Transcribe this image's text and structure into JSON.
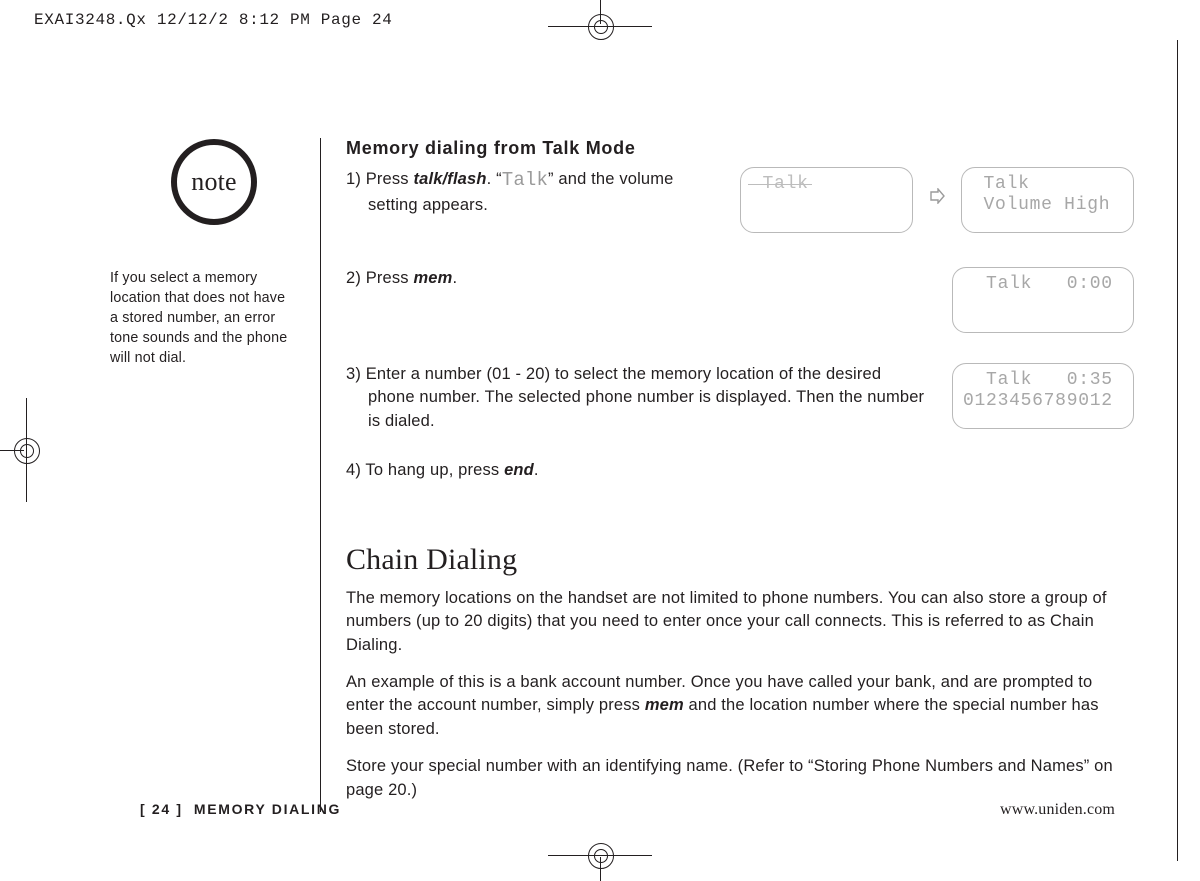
{
  "print_header": "EXAI3248.Qx  12/12/2  8:12 PM  Page 24",
  "sidebar": {
    "note_label": "note",
    "note_text": "If you select a memory location that does not have a stored number, an error tone sounds and the phone will not dial."
  },
  "main": {
    "h3": "Memory dialing from Talk Mode",
    "step1_a": "1) Press ",
    "step1_key": "talk/flash",
    "step1_b": ". “",
    "step1_lcd_word": "Talk",
    "step1_c": "” and the volume setting appears.",
    "step2_a": "2) Press ",
    "step2_key": "mem",
    "step2_b": ".",
    "step3_a": "3) Enter a number (01 - 20) to select the memory location of the desired phone number. The selected phone number is displayed. Then the number is dialed.",
    "step4_a": "4) To hang up, press ",
    "step4_key": "end",
    "step4_b": ".",
    "chain_title": "Chain Dialing",
    "chain_p1": "The memory locations on the handset are not limited to phone numbers. You can also store a group of numbers (up to 20 digits) that you need to enter once your call connects. This is referred to as Chain Dialing.",
    "chain_p2_a": "An example of this is a bank account number. Once you have called your bank, and are prompted to enter the account number, simply press ",
    "chain_p2_key": "mem",
    "chain_p2_b": " and the location number where the special number has been stored.",
    "chain_p3": "Store your special number with an identifying name. (Refer to “Storing Phone Numbers and Names” on page 20.)"
  },
  "lcd": {
    "box1_line1": " Talk",
    "box2_line1": " Talk",
    "box2_line2": " Volume High",
    "box3_line1": "  Talk   0:00",
    "box4_line1": "  Talk   0:35",
    "box4_line2": "0123456789012"
  },
  "footer": {
    "page_num": "[ 24 ]",
    "section": "MEMORY  DIALING",
    "url": "www.uniden.com"
  }
}
